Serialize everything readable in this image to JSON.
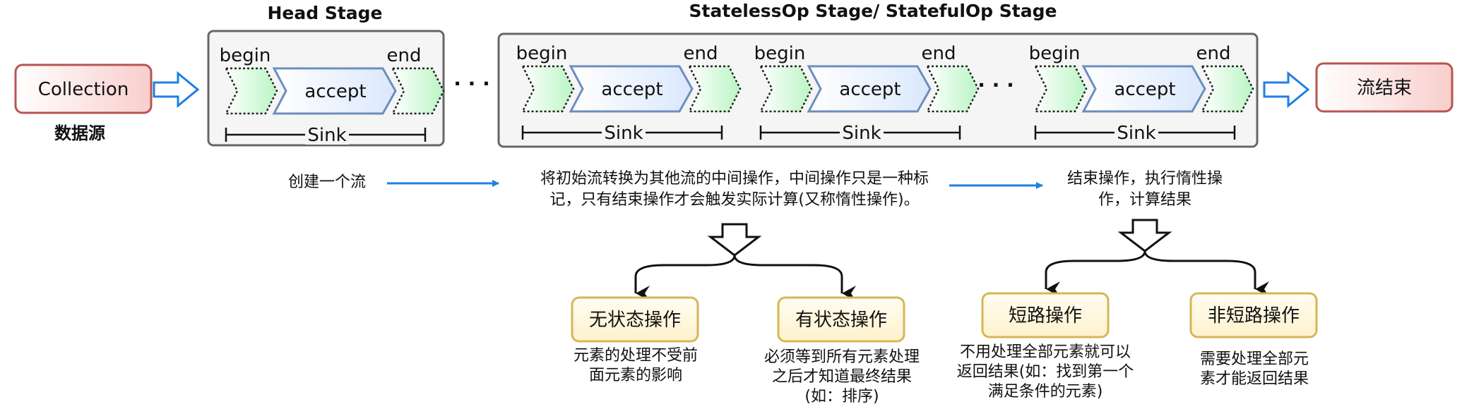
{
  "source": {
    "label": "Collection",
    "caption": "数据源"
  },
  "sink_end": {
    "label": "流结束"
  },
  "stages": {
    "head_title": "Head Stage",
    "mid_title": "StatelessOp Stage/ StatefulOp Stage",
    "ellipsis": "· · ·"
  },
  "sink_unit": {
    "begin": "begin",
    "accept": "accept",
    "end": "end",
    "sink": "Sink"
  },
  "flow": {
    "create": "创建一个流",
    "intermediate_line1": "将初始流转换为其他流的中间操作，中间操作只是一种标",
    "intermediate_line2": "记，只有结束操作才会触发实际计算(又称惰性操作)。",
    "terminal_line1": "结束操作，执行惰性操",
    "terminal_line2": "作，计算结果"
  },
  "categories": {
    "stateless": {
      "label": "无状态操作",
      "desc": [
        "元素的处理不受前",
        "面元素的影响"
      ]
    },
    "stateful": {
      "label": "有状态操作",
      "desc": [
        "必须等到所有元素处理",
        "之后才知道最终结果",
        "(如：排序)"
      ]
    },
    "short_circuit": {
      "label": "短路操作",
      "desc": [
        "不用处理全部元素就可以",
        "返回结果(如：找到第一个",
        "满足条件的元素)"
      ]
    },
    "non_short_circuit": {
      "label": "非短路操作",
      "desc": [
        "需要处理全部元",
        "素才能返回结果"
      ]
    }
  },
  "colors": {
    "source_fill": "#f8cecc",
    "source_stroke": "#b85450",
    "stage_fill": "#f5f5f5",
    "stage_stroke": "#666666",
    "accept_fill": "#dae8fc",
    "accept_stroke": "#6c8ebf",
    "chevron_fill": "#ccffcc",
    "category_fill": "#fff2cc",
    "category_stroke": "#d6b656",
    "flow_arrow": "#1e7fe6"
  }
}
